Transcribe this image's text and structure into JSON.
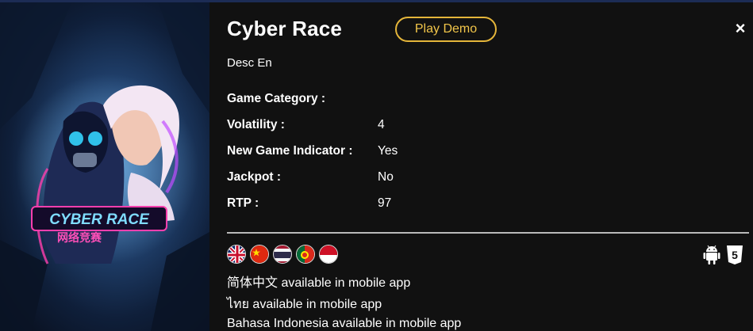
{
  "game": {
    "title": "Cyber Race",
    "play_demo_label": "Play Demo",
    "close_glyph": "×",
    "description": "Desc En",
    "logo_text": "CYBER RACE",
    "logo_subtext": "网络竞赛"
  },
  "details": [
    {
      "label": "Game Category :",
      "value": ""
    },
    {
      "label": "Volatility :",
      "value": "4"
    },
    {
      "label": "New Game Indicator :",
      "value": "Yes"
    },
    {
      "label": "Jackpot :",
      "value": "No"
    },
    {
      "label": "RTP :",
      "value": "97"
    }
  ],
  "languages": [
    {
      "name": "uk-flag-icon"
    },
    {
      "name": "china-flag-icon"
    },
    {
      "name": "thailand-flag-icon"
    },
    {
      "name": "portugal-flag-icon"
    },
    {
      "name": "indonesia-flag-icon"
    }
  ],
  "platforms": [
    {
      "name": "android-icon"
    },
    {
      "name": "html5-icon",
      "text": "5"
    }
  ],
  "availability": [
    "简体中文 available in mobile app",
    "ไทย available in mobile app",
    "Bahasa Indonesia available in mobile app"
  ],
  "colors": {
    "accent": "#e4b53a",
    "panel_bg": "#111111",
    "divider": "#b9b9b9"
  }
}
